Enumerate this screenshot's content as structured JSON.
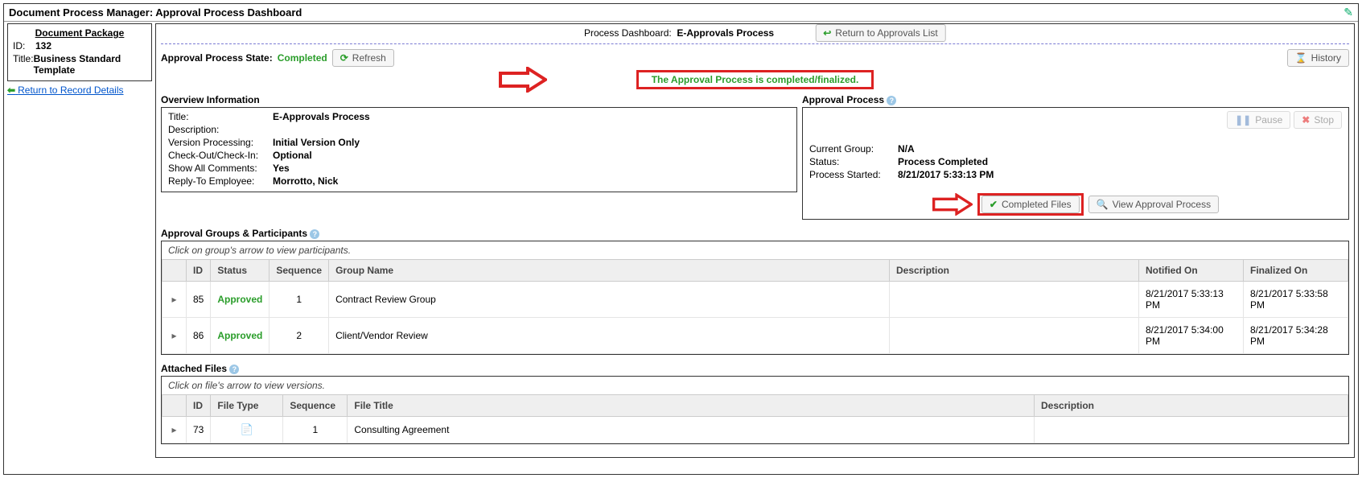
{
  "page_title": "Document Process Manager: Approval Process Dashboard",
  "package": {
    "heading": "Document Package",
    "id_label": "ID:",
    "id_value": "132",
    "title_label": "Title:",
    "title_value": "Business Standard Template",
    "return_link": "Return to Record Details"
  },
  "dashboard": {
    "label": "Process Dashboard:",
    "process_name": "E-Approvals Process",
    "return_button": "Return to Approvals List"
  },
  "state": {
    "label": "Approval Process State:",
    "value": "Completed",
    "refresh": "Refresh",
    "history": "History"
  },
  "banner": "The Approval Process is completed/finalized.",
  "overview": {
    "heading": "Overview Information",
    "rows": {
      "title_l": "Title:",
      "title_v": "E-Approvals Process",
      "desc_l": "Description:",
      "desc_v": "",
      "ver_l": "Version Processing:",
      "ver_v": "Initial Version Only",
      "check_l": "Check-Out/Check-In:",
      "check_v": "Optional",
      "show_l": "Show All Comments:",
      "show_v": "Yes",
      "reply_l": "Reply-To Employee:",
      "reply_v": "Morrotto, Nick"
    }
  },
  "approval": {
    "heading": "Approval Process",
    "pause": "Pause",
    "stop": "Stop",
    "group_l": "Current Group:",
    "group_v": "N/A",
    "status_l": "Status:",
    "status_v": "Process Completed",
    "started_l": "Process Started:",
    "started_v": "8/21/2017 5:33:13 PM",
    "completed_files": "Completed Files",
    "view_process": "View Approval Process"
  },
  "groups": {
    "heading": "Approval Groups & Participants",
    "hint": "Click on group's arrow to view participants.",
    "cols": {
      "id": "ID",
      "status": "Status",
      "seq": "Sequence",
      "name": "Group Name",
      "desc": "Description",
      "notified": "Notified On",
      "finalized": "Finalized On"
    },
    "rows": [
      {
        "id": "85",
        "status": "Approved",
        "seq": "1",
        "name": "Contract Review Group",
        "desc": "",
        "notified": "8/21/2017 5:33:13 PM",
        "finalized": "8/21/2017 5:33:58 PM"
      },
      {
        "id": "86",
        "status": "Approved",
        "seq": "2",
        "name": "Client/Vendor Review",
        "desc": "",
        "notified": "8/21/2017 5:34:00 PM",
        "finalized": "8/21/2017 5:34:28 PM"
      }
    ]
  },
  "files": {
    "heading": "Attached Files",
    "hint": "Click on file's arrow to view versions.",
    "cols": {
      "id": "ID",
      "type": "File Type",
      "seq": "Sequence",
      "title": "File Title",
      "desc": "Description"
    },
    "rows": [
      {
        "id": "73",
        "type": "doc",
        "seq": "1",
        "title": "Consulting Agreement",
        "desc": ""
      }
    ]
  }
}
